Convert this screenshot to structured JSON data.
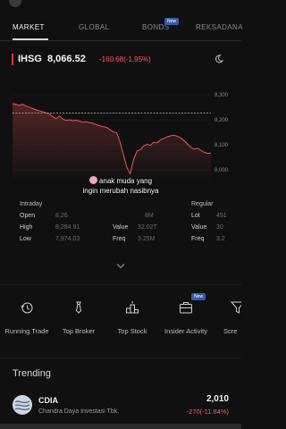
{
  "tabs": [
    {
      "label": "MARKET",
      "active": true
    },
    {
      "label": "GLOBAL",
      "active": false
    },
    {
      "label": "BONDS",
      "active": false,
      "badge": "New"
    },
    {
      "label": "REKSADANA",
      "active": false
    }
  ],
  "index": {
    "name": "IHSG",
    "value": "8,066.52",
    "change": "-160.68(-1.95%)",
    "color_down": "#ff5a64",
    "icon": "moon-icon"
  },
  "chart_data": {
    "type": "line",
    "y_ticks": [
      "8,300",
      "8,200",
      "8,100",
      "8,000"
    ],
    "ylim": [
      7950,
      8350
    ],
    "reference_line": 8227.2,
    "values": [
      8265,
      8262,
      8258,
      8262,
      8255,
      8250,
      8245,
      8240,
      8236,
      8232,
      8228,
      8222,
      8212,
      8205,
      8215,
      8202,
      8198,
      8200,
      8196,
      8198,
      8195,
      8190,
      8192,
      8188,
      8186,
      8180,
      8176,
      8172,
      8170,
      8160,
      8152,
      8148,
      8110,
      8060,
      8010,
      7985,
      8040,
      8075,
      8080,
      8095,
      8102,
      8098,
      8110,
      8108,
      8120,
      8125,
      8132,
      8136,
      8138,
      8134,
      8128,
      8116,
      8104,
      8090,
      8082,
      8086,
      8078,
      8070,
      8066,
      8067
    ],
    "line_color": "#ff5a64"
  },
  "stats": {
    "intraday_header": "Intraday",
    "open_label": "Open",
    "open_value": "8,26",
    "high_label": "High",
    "high_value": "8,284.91",
    "low_label": "Low",
    "low_value": "7,974.03",
    "value_label": "Value",
    "value_value": "32.02T",
    "freq_label": "Freq",
    "freq_value": "3.25M",
    "vol_value": "8M",
    "regular_header": "Regular",
    "lot_label": "Lot",
    "lot_value": "451",
    "rvalue_label": "Value",
    "rvalue_value": "30",
    "rfreq_label": "Freq",
    "rfreq_value": "3.2"
  },
  "caption": {
    "line1": "anak muda yang",
    "line2": "ingin merubah nasibnya"
  },
  "menu": [
    {
      "label": "Running Trade",
      "icon": "history-icon"
    },
    {
      "label": "Top Broker",
      "icon": "tie-icon"
    },
    {
      "label": "Top Stock",
      "icon": "podium-icon"
    },
    {
      "label": "Insider Activity",
      "icon": "briefcase-icon",
      "badge": "New"
    },
    {
      "label": "Scre",
      "icon": "filter-icon"
    }
  ],
  "trending": {
    "title": "Trending",
    "items": [
      {
        "code": "CDIA",
        "company": "Chandra Daya Investasi Tbk.",
        "price": "2,010",
        "change": "-270(-11.84%)"
      }
    ]
  }
}
